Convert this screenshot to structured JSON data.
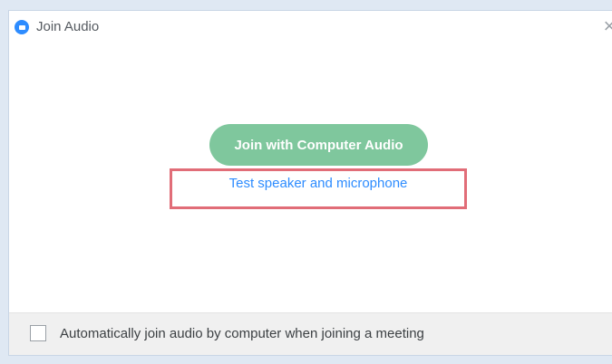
{
  "window": {
    "title": "Join Audio",
    "close_glyph": "×",
    "icons": {
      "app_logo": "zoom-logo-icon",
      "close": "close-icon"
    }
  },
  "main": {
    "join_button_label": "Join with Computer Audio",
    "test_link_label": "Test speaker and microphone"
  },
  "footer": {
    "auto_join_checked": false,
    "auto_join_label": "Automatically join audio by computer when joining a meeting"
  },
  "colors": {
    "accent": "#2d8cff",
    "join_button": "#7fc79d",
    "highlight": "#e16d78"
  }
}
